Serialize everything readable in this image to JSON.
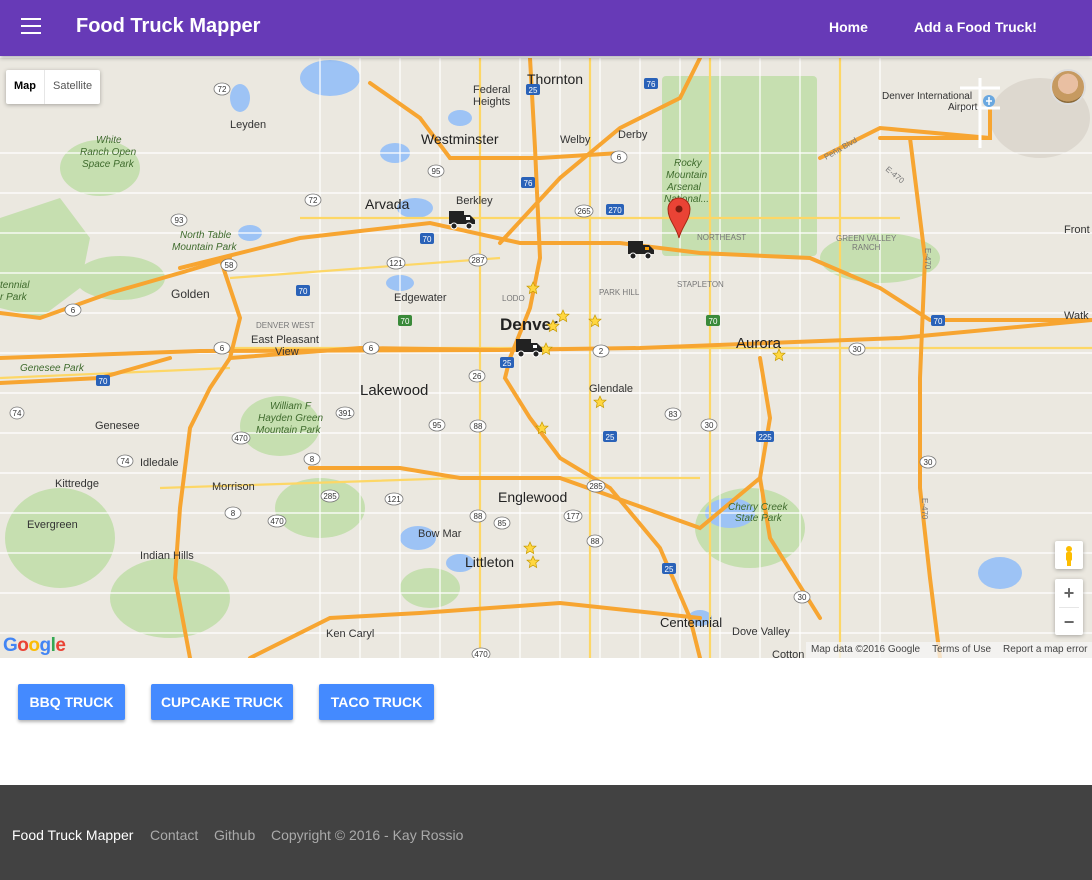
{
  "header": {
    "title": "Food Truck Mapper",
    "nav": [
      "Home",
      "Add a Food Truck!"
    ]
  },
  "map": {
    "map_type_options": [
      "Map",
      "Satellite"
    ],
    "selected_map_type": "Map",
    "attribution": [
      "Map data ©2016 Google",
      "Terms of Use",
      "Report a map error"
    ],
    "logo": "Google",
    "zoom_in": "+",
    "zoom_out": "−",
    "big_labels": [
      "Denver",
      "Aurora",
      "Lakewood",
      "Westminster",
      "Arvada",
      "Englewood",
      "Littleton",
      "Centennial",
      "Thornton"
    ],
    "labels": [
      "Federal Heights",
      "Welby",
      "Derby",
      "Berkley",
      "Golden",
      "Edgewater",
      "Leyden",
      "Glendale",
      "Genesee",
      "Idledale",
      "Kittredge",
      "Morrison",
      "Evergreen",
      "Indian Hills",
      "Bow Mar",
      "Ken Caryl",
      "Dove Valley",
      "Cherry Creek State Park",
      "White Ranch Open Space Park",
      "North Table Mountain Park",
      "Rocky Mountain Arsenal National...",
      "Denver International Airport",
      "East Pleasant View",
      "William F Hayden Green Mountain Park",
      "Genesee Park",
      "Front",
      "Watk",
      "Cotton"
    ],
    "small_labels": [
      "NORTHEAST",
      "STAPLETON",
      "PARK HILL",
      "LODO",
      "DENVER WEST",
      "GREEN VALLEY RANCH",
      "Peña Blvd",
      "E-470"
    ],
    "highway_shields": [
      "25",
      "76",
      "70",
      "270",
      "225",
      "6",
      "72",
      "93",
      "58",
      "121",
      "287",
      "391",
      "95",
      "88",
      "26",
      "2",
      "83",
      "30",
      "285",
      "8",
      "470",
      "85",
      "177",
      "74"
    ],
    "markers": {
      "food_trucks": 3,
      "favorites": 10,
      "pin": "selected-location"
    }
  },
  "buttons": [
    "BBQ TRUCK",
    "CUPCAKE TRUCK",
    "TACO TRUCK"
  ],
  "footer": {
    "brand": "Food Truck Mapper",
    "links": [
      "Contact",
      "Github"
    ],
    "copyright": "Copyright © 2016 - Kay Rossio"
  },
  "colors": {
    "appbar": "#673ab7",
    "button": "#448aff",
    "footer": "#424242",
    "highway": "#f7a531",
    "park": "#c6dfb0",
    "water": "#9dc3f5"
  }
}
